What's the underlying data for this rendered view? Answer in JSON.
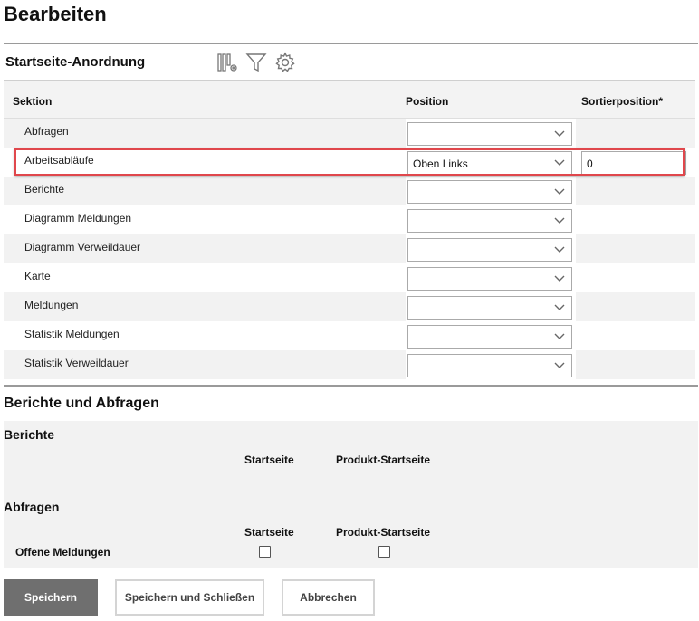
{
  "page": {
    "title": "Bearbeiten"
  },
  "arrangement": {
    "title": "Startseite-Anordnung",
    "toolbar_icons": [
      "columns-settings-icon",
      "filter-icon",
      "gear-icon"
    ],
    "columns": {
      "section": "Sektion",
      "position": "Position",
      "sort": "Sortierposition*"
    },
    "rows": [
      {
        "label": "Abfragen",
        "position": "",
        "sort": null
      },
      {
        "label": "Arbeitsabläufe",
        "position": "Oben Links",
        "sort": "0",
        "highlighted": true
      },
      {
        "label": "Berichte",
        "position": "",
        "sort": null
      },
      {
        "label": "Diagramm Meldungen",
        "position": "",
        "sort": null
      },
      {
        "label": "Diagramm Verweildauer",
        "position": "",
        "sort": null
      },
      {
        "label": "Karte",
        "position": "",
        "sort": null
      },
      {
        "label": "Meldungen",
        "position": "",
        "sort": null
      },
      {
        "label": "Statistik Meldungen",
        "position": "",
        "sort": null
      },
      {
        "label": "Statistik Verweildauer",
        "position": "",
        "sort": null
      }
    ]
  },
  "reports": {
    "title": "Berichte und Abfragen",
    "berichte": {
      "title": "Berichte",
      "col_start": "Startseite",
      "col_product": "Produkt-Startseite"
    },
    "abfragen": {
      "title": "Abfragen",
      "col_start": "Startseite",
      "col_product": "Produkt-Startseite",
      "items": [
        {
          "label": "Offene Meldungen",
          "start": false,
          "product": false
        }
      ]
    }
  },
  "buttons": {
    "save": "Speichern",
    "save_close": "Speichern und Schließen",
    "cancel": "Abbrechen"
  },
  "colors": {
    "highlight": "#e0474c",
    "primary_button": "#6f6f6f",
    "row_alt": "#f2f2f2"
  }
}
